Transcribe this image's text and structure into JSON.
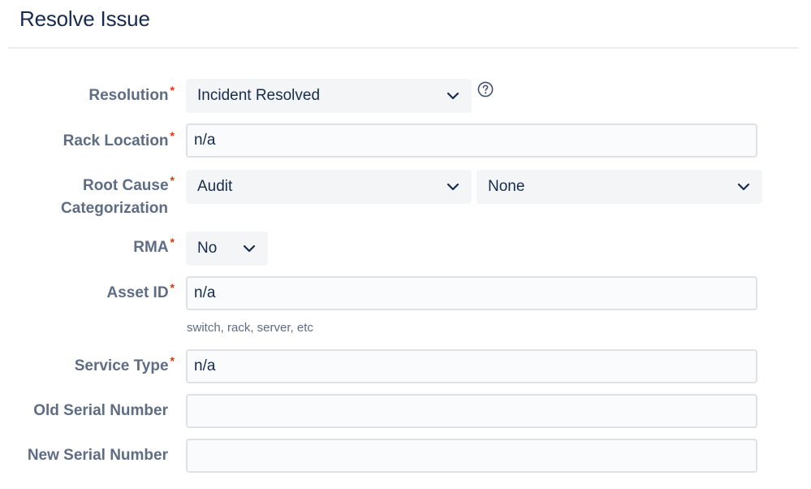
{
  "dialog": {
    "title": "Resolve Issue"
  },
  "form": {
    "required_marker": "*",
    "resolution": {
      "label": "Resolution",
      "value": "Incident Resolved"
    },
    "rack_location": {
      "label": "Rack Location",
      "value": "n/a"
    },
    "root_cause": {
      "label_line1": "Root Cause",
      "label_line2": "Categorization",
      "value": "Audit",
      "sub_value": "None"
    },
    "rma": {
      "label": "RMA",
      "value": "No"
    },
    "asset_id": {
      "label": "Asset ID",
      "value": "n/a",
      "hint": "switch, rack, server, etc"
    },
    "service_type": {
      "label": "Service Type",
      "value": "n/a"
    },
    "old_serial": {
      "label": "Old Serial Number",
      "value": ""
    },
    "new_serial": {
      "label": "New Serial Number",
      "value": ""
    }
  },
  "icons": {
    "help": "question-circle-icon",
    "dropdown": "chevron-down-icon"
  },
  "colors": {
    "required": "#de350b",
    "label": "#5e6c84",
    "text": "#172b4d",
    "field_bg": "#f4f5f7"
  }
}
